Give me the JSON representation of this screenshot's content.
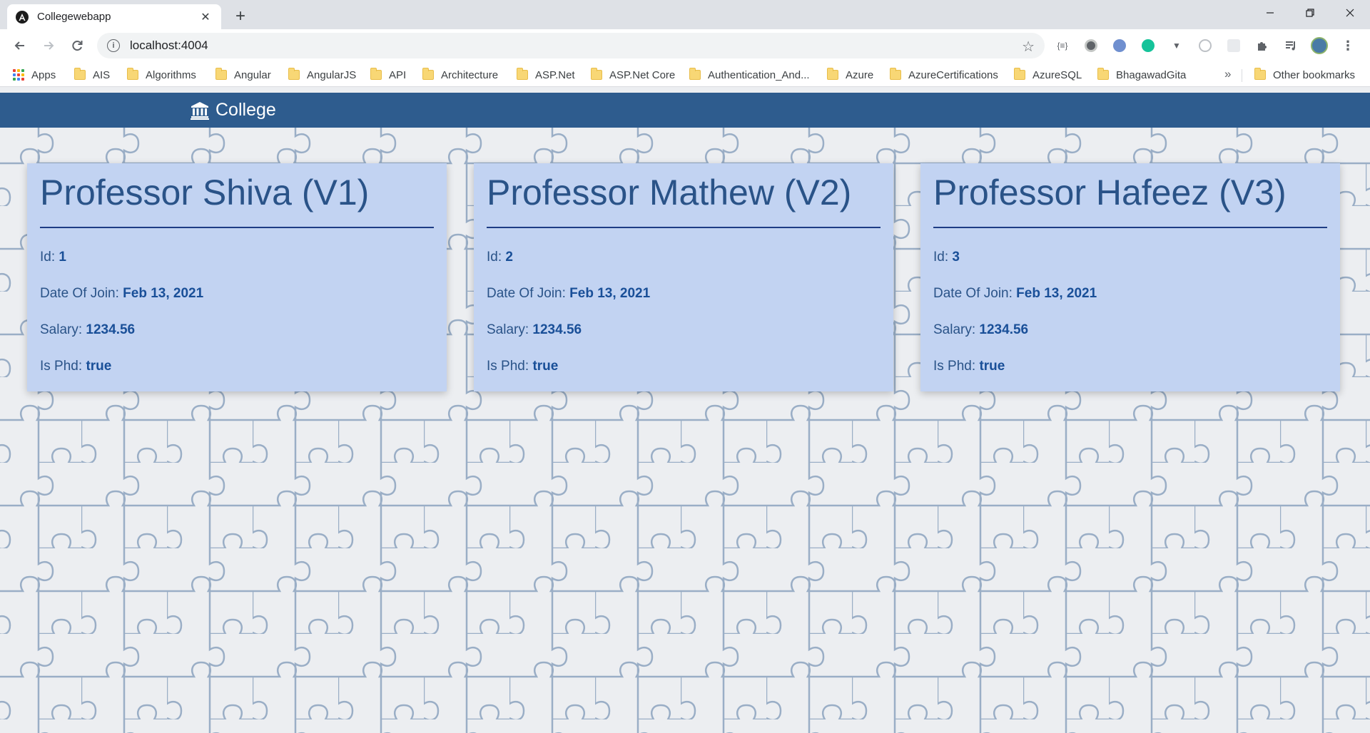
{
  "browser": {
    "tab_title": "Collegewebapp",
    "url": "localhost:4004",
    "bookmarks": [
      {
        "label": "Apps",
        "kind": "apps"
      },
      {
        "label": "AIS"
      },
      {
        "label": "Algorithms"
      },
      {
        "label": "Angular"
      },
      {
        "label": "AngularJS"
      },
      {
        "label": "API"
      },
      {
        "label": "Architecture"
      },
      {
        "label": "ASP.Net"
      },
      {
        "label": "ASP.Net Core"
      },
      {
        "label": "Authentication_And..."
      },
      {
        "label": "Azure"
      },
      {
        "label": "AzureCertifications"
      },
      {
        "label": "AzureSQL"
      },
      {
        "label": "BhagawadGita"
      }
    ],
    "more_bookmarks": "»",
    "other_bookmarks": "Other bookmarks"
  },
  "app": {
    "brand": "College",
    "nav_color": "#2e5c8e",
    "card_color": "#c2d3f2"
  },
  "professors": [
    {
      "title": "Professor Shiva (V1)",
      "id_label": "Id:",
      "id": "1",
      "doj_label": "Date Of Join:",
      "doj": "Feb 13, 2021",
      "salary_label": "Salary:",
      "salary": "1234.56",
      "phd_label": "Is Phd:",
      "phd": "true"
    },
    {
      "title": "Professor Mathew (V2)",
      "id_label": "Id:",
      "id": "2",
      "doj_label": "Date Of Join:",
      "doj": "Feb 13, 2021",
      "salary_label": "Salary:",
      "salary": "1234.56",
      "phd_label": "Is Phd:",
      "phd": "true"
    },
    {
      "title": "Professor Hafeez (V3)",
      "id_label": "Id:",
      "id": "3",
      "doj_label": "Date Of Join:",
      "doj": "Feb 13, 2021",
      "salary_label": "Salary:",
      "salary": "1234.56",
      "phd_label": "Is Phd:",
      "phd": "true"
    }
  ]
}
